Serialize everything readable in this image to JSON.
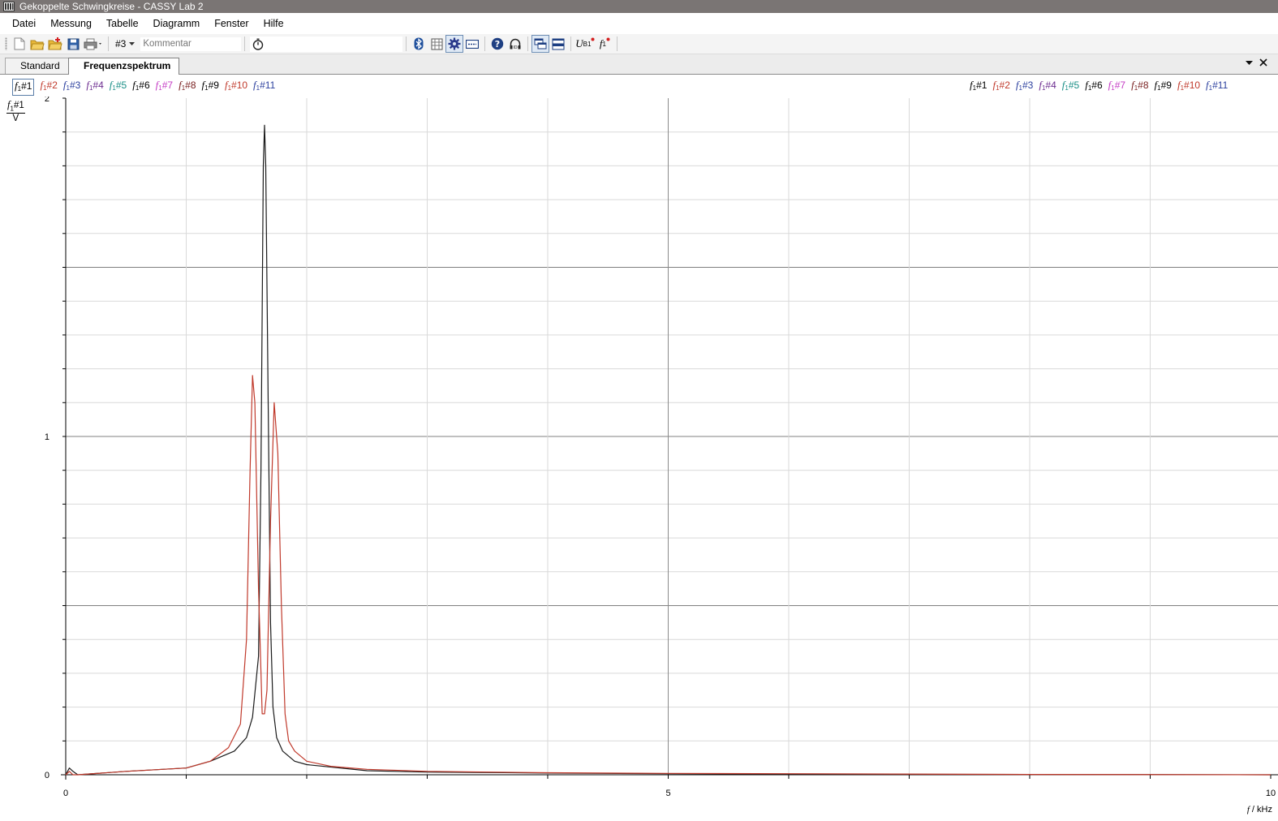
{
  "window": {
    "title": "Gekoppelte Schwingkreise - CASSY Lab 2"
  },
  "menu": {
    "items": [
      "Datei",
      "Messung",
      "Tabelle",
      "Diagramm",
      "Fenster",
      "Hilfe"
    ]
  },
  "toolbar": {
    "measurement_selector": "#3",
    "comment_placeholder": "Kommentar",
    "icons": [
      "new-icon",
      "open-icon",
      "open-add-icon",
      "save-icon",
      "print-icon",
      "timer-icon",
      "bluetooth-icon",
      "table-icon",
      "settings-icon",
      "display-icon",
      "help-icon",
      "headset-icon",
      "window-layout-1-icon",
      "window-layout-2-icon"
    ],
    "ub1_label": "U",
    "ub1_sub": "B1",
    "f1_label": "f",
    "f1_sub": "1"
  },
  "tabs": {
    "items": [
      {
        "label": "Standard",
        "selected": false
      },
      {
        "label": "Frequenzspektrum",
        "selected": true
      }
    ]
  },
  "channels": {
    "left": [
      {
        "var": "f",
        "sub": "1",
        "id": "#1",
        "color": "#000000"
      },
      {
        "var": "f",
        "sub": "1",
        "id": "#2",
        "color": "#c0392b"
      },
      {
        "var": "f",
        "sub": "1",
        "id": "#3",
        "color": "#2b3f9e"
      },
      {
        "var": "f",
        "sub": "1",
        "id": "#4",
        "color": "#6b2b8f"
      },
      {
        "var": "f",
        "sub": "1",
        "id": "#5",
        "color": "#1a8f87"
      },
      {
        "var": "f",
        "sub": "1",
        "id": "#6",
        "color": "#000000"
      },
      {
        "var": "f",
        "sub": "1",
        "id": "#7",
        "color": "#c43bc4"
      },
      {
        "var": "f",
        "sub": "1",
        "id": "#8",
        "color": "#7a2222"
      },
      {
        "var": "f",
        "sub": "1",
        "id": "#9",
        "color": "#000000"
      },
      {
        "var": "f",
        "sub": "1",
        "id": "#10",
        "color": "#c0392b"
      },
      {
        "var": "f",
        "sub": "1",
        "id": "#11",
        "color": "#2b3f9e"
      }
    ]
  },
  "chart_data": {
    "type": "line",
    "y_axis_label": {
      "var": "f",
      "sub": "1",
      "id": "#1",
      "unit": "V"
    },
    "x_axis_label": {
      "var": "f",
      "unit": "kHz"
    },
    "xlim": [
      0,
      10
    ],
    "ylim": [
      0,
      2
    ],
    "x_tick_labels": [
      "0",
      "5",
      "10"
    ],
    "y_tick_labels": [
      "0",
      "1",
      "2"
    ],
    "grid": true,
    "series": [
      {
        "channel": "#1",
        "color": "#1a1a1a",
        "x": [
          0,
          0.03,
          0.06,
          0.1,
          0.5,
          1.0,
          1.2,
          1.4,
          1.5,
          1.55,
          1.6,
          1.62,
          1.64,
          1.65,
          1.66,
          1.68,
          1.7,
          1.72,
          1.75,
          1.8,
          1.9,
          2.0,
          2.5,
          3,
          4,
          5,
          6,
          8,
          10
        ],
        "y": [
          0.0,
          0.02,
          0.01,
          0.0,
          0.01,
          0.02,
          0.04,
          0.07,
          0.11,
          0.17,
          0.35,
          0.9,
          1.8,
          1.92,
          1.8,
          1.1,
          0.45,
          0.2,
          0.11,
          0.07,
          0.04,
          0.03,
          0.012,
          0.008,
          0.005,
          0.003,
          0.002,
          0.001,
          0.0
        ]
      },
      {
        "channel": "#2",
        "color": "#c0392b",
        "x": [
          0,
          0.03,
          0.06,
          0.1,
          0.5,
          1.0,
          1.2,
          1.35,
          1.45,
          1.5,
          1.53,
          1.55,
          1.57,
          1.6,
          1.63,
          1.65,
          1.67,
          1.7,
          1.73,
          1.76,
          1.79,
          1.82,
          1.85,
          1.9,
          2.0,
          2.2,
          2.5,
          3,
          4,
          5,
          6,
          8,
          10
        ],
        "y": [
          0.0,
          0.01,
          0.0,
          0.0,
          0.01,
          0.02,
          0.04,
          0.08,
          0.15,
          0.4,
          0.9,
          1.18,
          1.1,
          0.55,
          0.18,
          0.18,
          0.25,
          0.75,
          1.1,
          0.95,
          0.5,
          0.18,
          0.1,
          0.07,
          0.04,
          0.025,
          0.016,
          0.01,
          0.006,
          0.004,
          0.003,
          0.001,
          0.0
        ]
      }
    ]
  }
}
